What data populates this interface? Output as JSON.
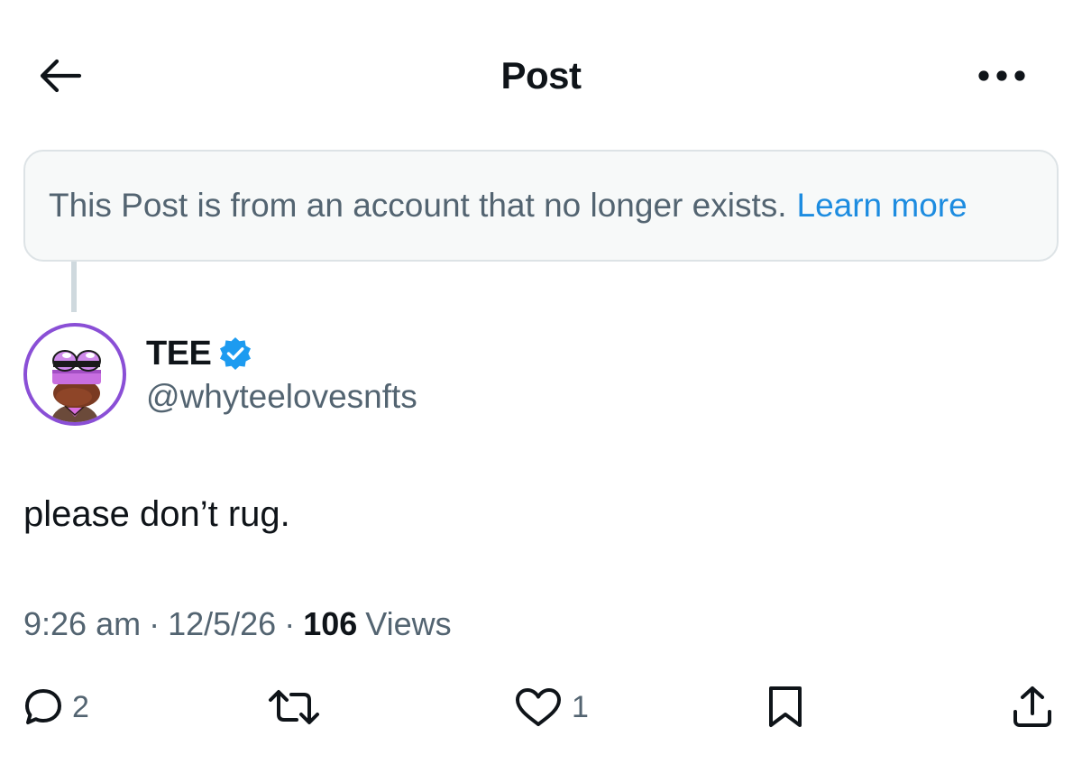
{
  "header": {
    "back_icon": "arrow-left-icon",
    "title": "Post",
    "more_icon": "more-horizontal-icon"
  },
  "notice": {
    "text": "This Post is from an account that no longer exists.",
    "link_label": "Learn more",
    "link_color": "#1d8ce0"
  },
  "author": {
    "name": "TEE",
    "handle": "@whyteelovesnfts",
    "verified_icon": "verified-badge-icon",
    "avatar_ring_color": "#8a4fd6"
  },
  "post": {
    "text": "please don’t rug."
  },
  "meta": {
    "time": "9:26 am",
    "separator": "·",
    "date": "12/5/26",
    "views_count": "106",
    "views_label": "Views"
  },
  "actions": {
    "reply": {
      "icon": "reply-icon",
      "count": "2"
    },
    "repost": {
      "icon": "repost-icon",
      "count": ""
    },
    "like": {
      "icon": "heart-icon",
      "count": "1"
    },
    "bookmark": {
      "icon": "bookmark-icon"
    },
    "share": {
      "icon": "share-icon"
    }
  }
}
